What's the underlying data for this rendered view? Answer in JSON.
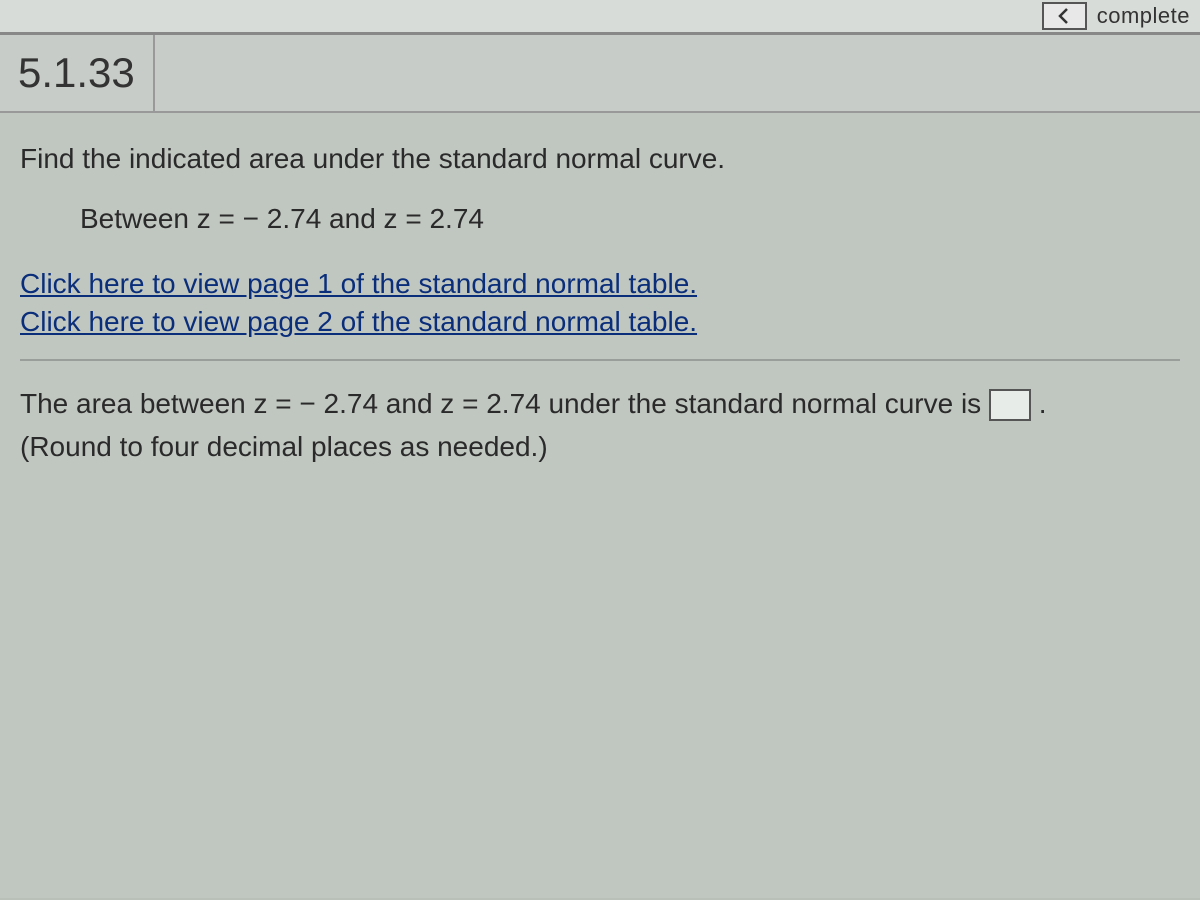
{
  "topbar": {
    "completion_text": "complete"
  },
  "question": {
    "number": "5.1.33",
    "instruction": "Find the indicated area under the standard normal curve.",
    "sub_instruction": "Between z = − 2.74 and z = 2.74",
    "link1": "Click here to view page 1 of the standard normal table.",
    "link2": "Click here to view page 2 of the standard normal table.",
    "answer_prefix": "The area between z = − 2.74 and z = 2.74 under the standard normal curve is ",
    "answer_suffix": ".",
    "answer_value": "",
    "round_note": "(Round to four decimal places as needed.)"
  }
}
